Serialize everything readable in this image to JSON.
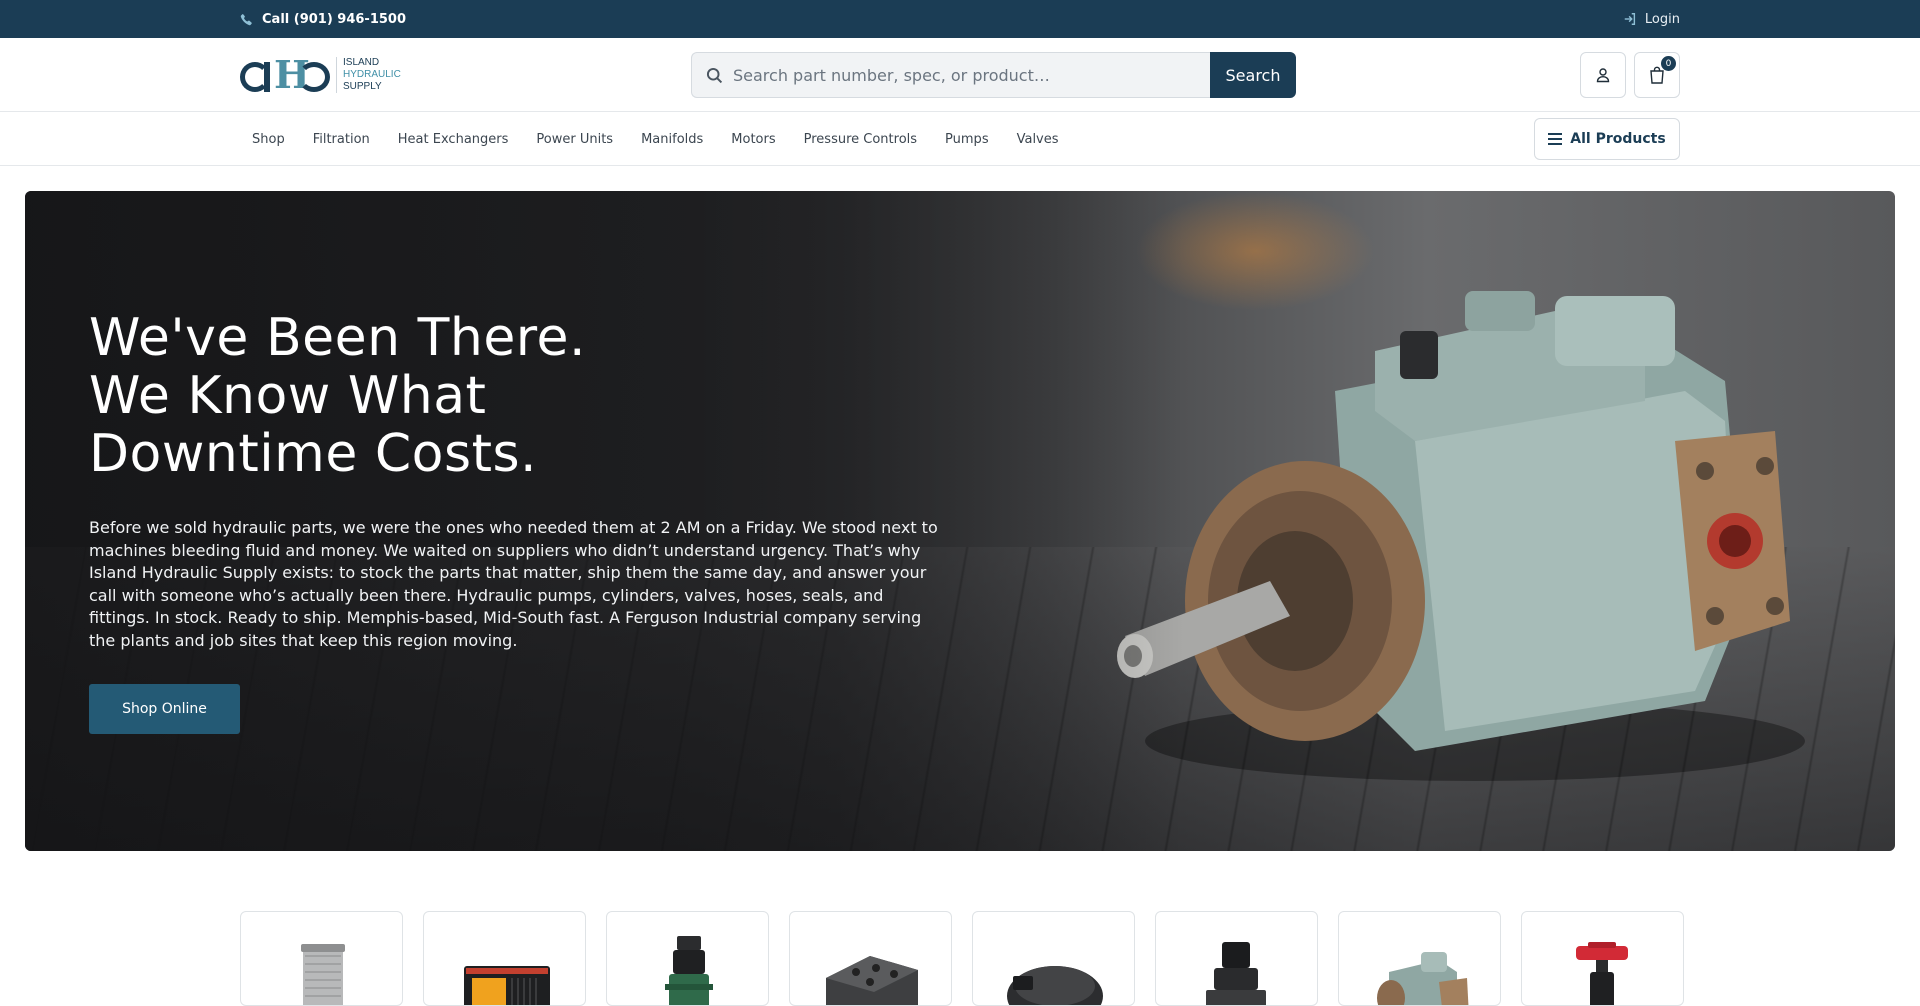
{
  "topbar": {
    "phone_icon": "phone-icon",
    "phone_label": "Call (901) 946-1500",
    "login_icon": "sign-in-icon",
    "login_label": "Login"
  },
  "logo": {
    "mark_letter": "H",
    "line1": "ISLAND",
    "line2": "HYDRAULIC",
    "line3": "SUPPLY"
  },
  "search": {
    "icon": "search-icon",
    "placeholder": "Search part number, spec, or product…",
    "button_label": "Search"
  },
  "account": {
    "icon": "user-icon"
  },
  "cart": {
    "icon": "shopping-bag-icon",
    "count": "0"
  },
  "nav": {
    "items": [
      "Shop",
      "Filtration",
      "Heat Exchangers",
      "Power Units",
      "Manifolds",
      "Motors",
      "Pressure Controls",
      "Pumps",
      "Valves"
    ],
    "all_products_icon": "menu-icon",
    "all_products_label": "All Products"
  },
  "hero": {
    "title_lines": [
      "We've Been There.",
      "We Know What",
      "Downtime Costs."
    ],
    "body": "Before we sold hydraulic parts, we were the ones who needed them at 2 AM on a Friday. We stood next to machines bleeding fluid and money. We waited on suppliers who didn’t understand urgency. That’s why Island Hydraulic Supply exists: to stock the parts that matter, ship them the same day, and answer your call with someone who’s actually been there. Hydraulic pumps, cylinders, valves, hoses, seals, and fittings. In stock. Ready to ship. Memphis-based, Mid-South fast. A Ferguson Industrial company serving the plants and job sites that keep this region moving.",
    "cta_label": "Shop Online",
    "image": "hydraulic-pump-photo"
  },
  "categories": [
    {
      "image": "filter-element-image"
    },
    {
      "image": "heat-exchanger-image"
    },
    {
      "image": "power-unit-image"
    },
    {
      "image": "manifold-block-image"
    },
    {
      "image": "hydraulic-motor-image"
    },
    {
      "image": "pressure-control-valve-image"
    },
    {
      "image": "hydraulic-pump-image"
    },
    {
      "image": "valve-handle-image"
    }
  ],
  "colors": {
    "brand_navy": "#1b3d55",
    "accent_teal": "#3f8fa7",
    "cta_blue": "#245a75"
  }
}
